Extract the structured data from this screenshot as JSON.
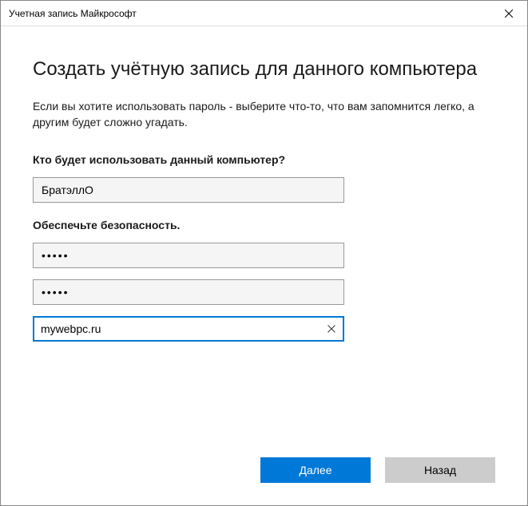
{
  "window": {
    "title": "Учетная запись Майкрософт"
  },
  "main": {
    "heading": "Создать учётную запись для данного компьютера",
    "description": "Если вы хотите использовать пароль - выберите что-то, что вам запомнится легко, а другим будет сложно угадать.",
    "who_label": "Кто будет использовать данный компьютер?",
    "username_value": "БратэллО",
    "security_label": "Обеспечьте безопасность.",
    "password_value": "•••••",
    "password_confirm_value": "•••••",
    "hint_value": "mywebpc.ru"
  },
  "footer": {
    "next_label": "Далее",
    "back_label": "Назад"
  }
}
